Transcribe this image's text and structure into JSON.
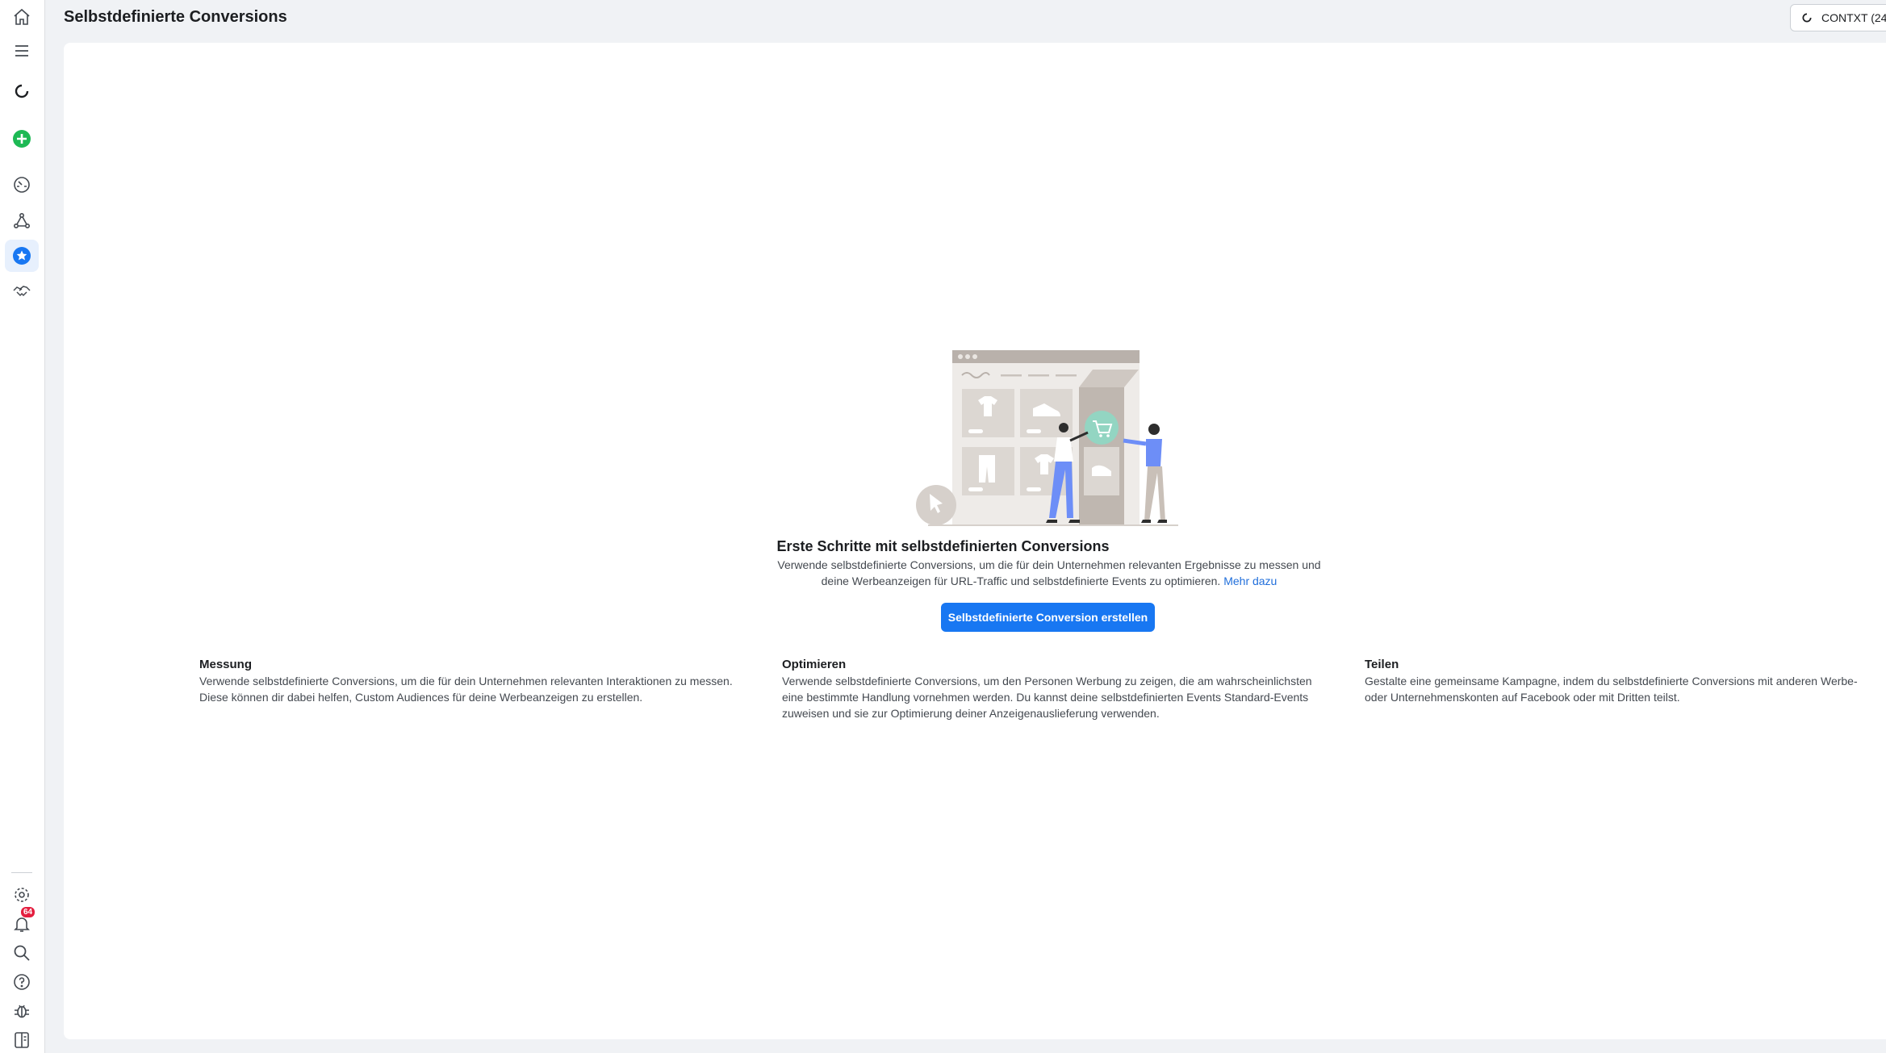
{
  "page": {
    "title": "Selbstdefinierte Conversions"
  },
  "context": {
    "label": "CONTXT (24"
  },
  "sidebar": {
    "icons": [
      "home-icon",
      "menu-icon",
      "loading-icon",
      "add-icon",
      "dashboard-icon",
      "network-icon",
      "star-icon",
      "handshake-icon"
    ],
    "bottom_icons": [
      "settings-icon",
      "notifications-icon",
      "search-icon",
      "help-icon",
      "bug-icon",
      "panel-icon"
    ],
    "notification_count": "64"
  },
  "hero": {
    "title": "Erste Schritte mit selbstdefinierten Conversions",
    "description": "Verwende selbstdefinierte Conversions, um die für dein Unternehmen relevanten Ergebnisse zu messen und deine Werbeanzeigen für URL-Traffic und selbstdefinierte Events zu optimieren.",
    "learn_more": "Mehr dazu",
    "cta_label": "Selbstdefinierte Conversion erstellen"
  },
  "features": [
    {
      "title": "Messung",
      "text": "Verwende selbstdefinierte Conversions, um die für dein Unternehmen relevanten Interaktionen zu messen. Diese können dir dabei helfen, Custom Audiences für deine Werbeanzeigen zu erstellen."
    },
    {
      "title": "Optimieren",
      "text": "Verwende selbstdefinierte Conversions, um den Personen Werbung zu zeigen, die am wahrscheinlichsten eine bestimmte Handlung vornehmen werden. Du kannst deine selbstdefinierten Events Standard-Events zuweisen und sie zur Optimierung deiner Anzeigenauslieferung verwenden."
    },
    {
      "title": "Teilen",
      "text": "Gestalte eine gemeinsame Kampagne, indem du selbstdefinierte Conversions mit anderen Werbe- oder Unternehmenskonten auf Facebook oder mit Dritten teilst."
    }
  ],
  "colors": {
    "accent": "#1877f2",
    "add_green": "#1db954",
    "link": "#216fdb",
    "badge_red": "#e41e3f"
  }
}
